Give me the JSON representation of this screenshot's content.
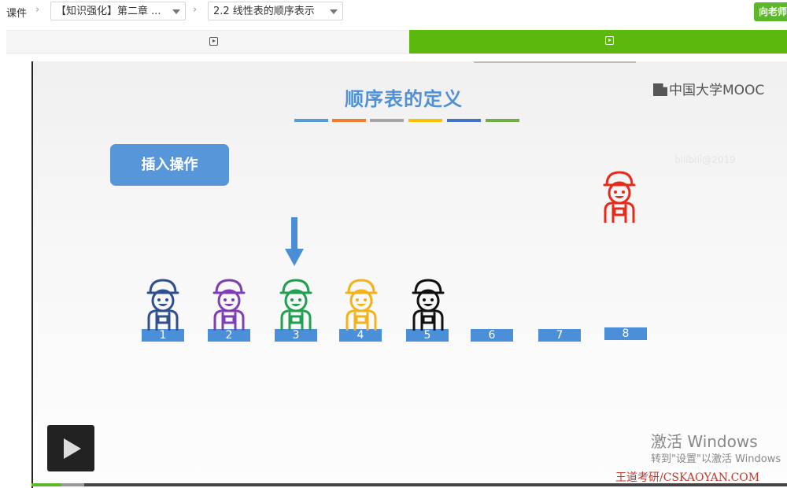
{
  "breadcrumb": {
    "root": "课件",
    "chapter_select": "【知识强化】第二章 ...",
    "section_select": "2.2 线性表的顺序表示"
  },
  "ask_teacher_label": "向老师",
  "tabs": [
    {
      "icon": "video-play-icon",
      "active": false
    },
    {
      "icon": "video-play-icon",
      "active": true
    }
  ],
  "slide": {
    "title": "顺序表的定义",
    "stripe_colors": [
      "#5b9bd5",
      "#ed7d31",
      "#a5a5a5",
      "#ffc000",
      "#4472c4",
      "#70ad47"
    ],
    "logo_text": "中国大学MOOC",
    "faint_watermark": "bilibili@2019",
    "insert_button": "插入操作",
    "slots": [
      "1",
      "2",
      "3",
      "4",
      "5",
      "6",
      "7",
      "8"
    ],
    "people_colors": [
      "#2f4f8f",
      "#7e3fb5",
      "#20a050",
      "#f3b21b",
      "#111111"
    ],
    "new_person_color": "#e82a1a",
    "insert_position": "3"
  },
  "activate": {
    "line1": "激活 Windows",
    "line2": "转到\"设置\"以激活 Windows"
  },
  "credit": "王道考研/CSKAOYAN.COM",
  "playback_progress": 0.04,
  "buffered_progress": 0.07
}
